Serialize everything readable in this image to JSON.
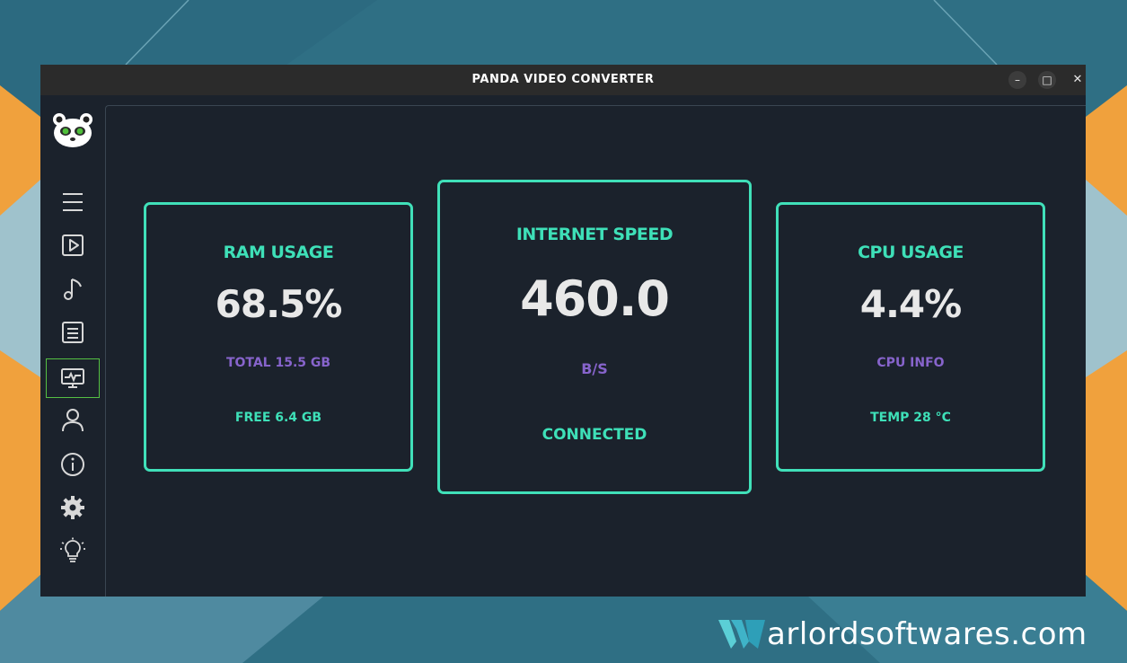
{
  "window": {
    "title": "PANDA VIDEO CONVERTER",
    "controls": {
      "minimize": "–",
      "maximize": "□",
      "close": "✕"
    }
  },
  "sidebar": {
    "items": [
      {
        "name": "menu",
        "icon": "hamburger-menu-icon"
      },
      {
        "name": "video",
        "icon": "play-icon"
      },
      {
        "name": "audio",
        "icon": "music-note-icon"
      },
      {
        "name": "list",
        "icon": "document-list-icon"
      },
      {
        "name": "monitor",
        "icon": "system-monitor-icon",
        "active": true
      },
      {
        "name": "account",
        "icon": "user-icon"
      },
      {
        "name": "info",
        "icon": "info-icon"
      },
      {
        "name": "settings",
        "icon": "gear-icon"
      },
      {
        "name": "ideas",
        "icon": "lightbulb-icon"
      }
    ]
  },
  "ram": {
    "heading": "RAM USAGE",
    "value": "68.5%",
    "total": "TOTAL 15.5 GB",
    "free": "FREE 6.4 GB"
  },
  "internet": {
    "heading": "INTERNET SPEED",
    "value": "460.0",
    "unit": "B/S",
    "status": "CONNECTED"
  },
  "cpu": {
    "heading": "CPU USAGE",
    "value": "4.4%",
    "info": "CPU INFO",
    "temp": "TEMP 28 °C"
  },
  "watermark": {
    "text": "arlordsoftwares.com"
  },
  "colors": {
    "accent": "#40e0b9",
    "purple": "#8764cc",
    "window_bg": "#1b222c",
    "active_outline": "#55c043",
    "background_orange": "#f0a13d"
  }
}
